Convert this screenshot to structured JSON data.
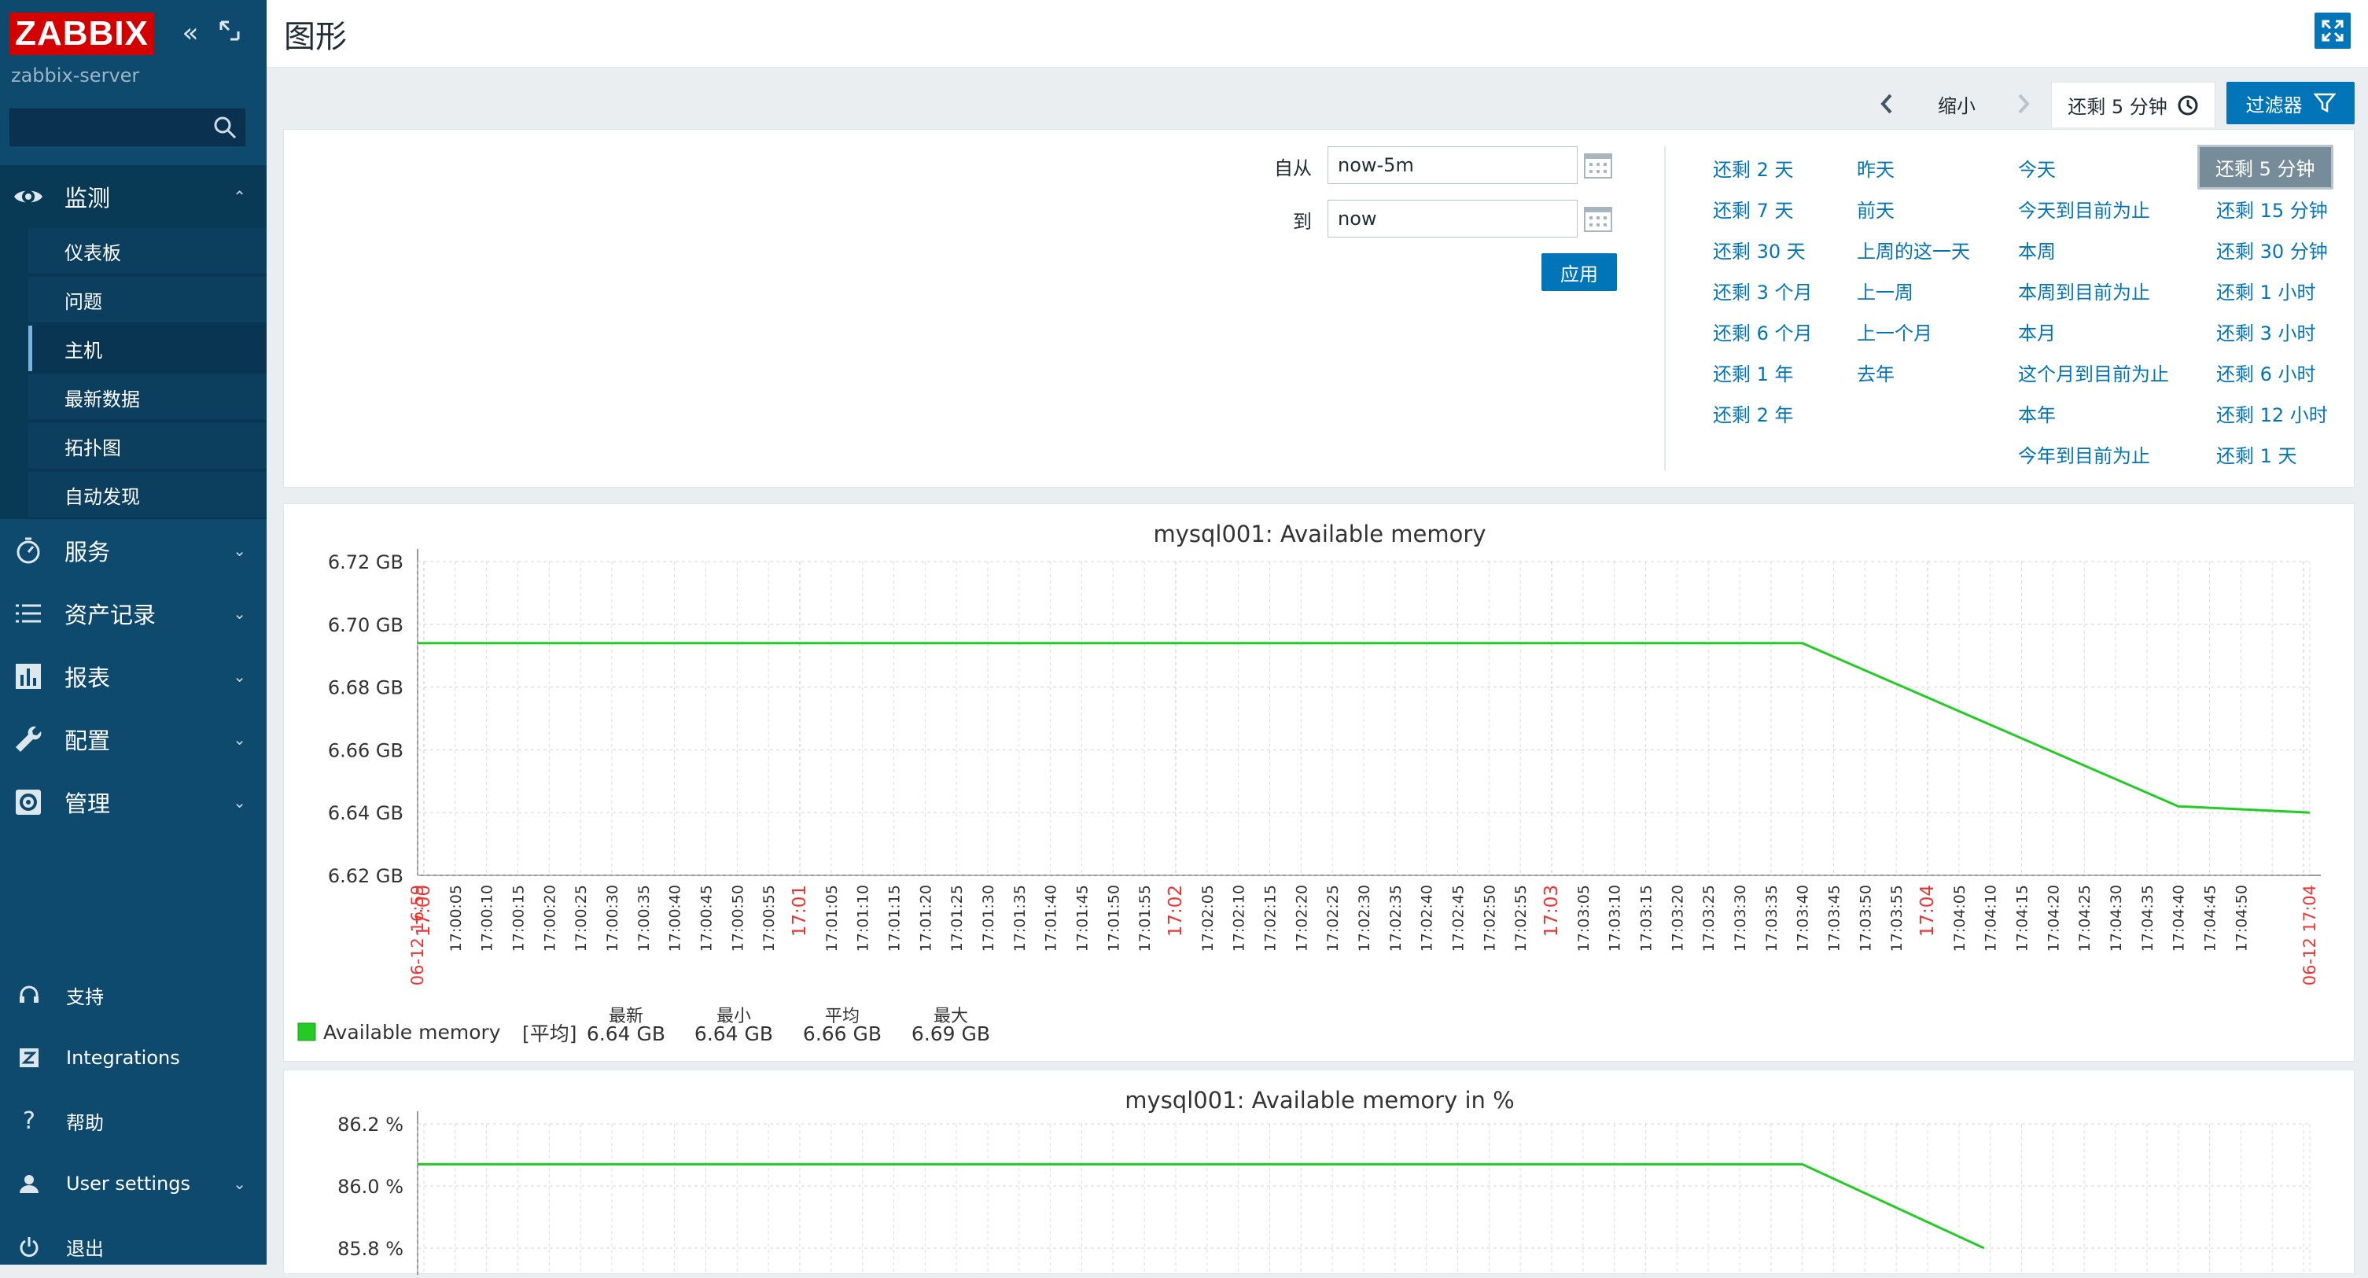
{
  "sidebar": {
    "logo": "ZABBIX",
    "server": "zabbix-server",
    "search_placeholder": "",
    "monitor": {
      "label": "监测",
      "items": [
        "仪表板",
        "问题",
        "主机",
        "最新数据",
        "拓扑图",
        "自动发现"
      ],
      "active_index": 2
    },
    "sections": [
      "服务",
      "资产记录",
      "报表",
      "配置",
      "管理"
    ],
    "footer": [
      "支持",
      "Integrations",
      "帮助",
      "User settings",
      "退出"
    ]
  },
  "header": {
    "title": "图形"
  },
  "timebar": {
    "zoom_out": "缩小",
    "active_tab": "还剩 5 分钟",
    "filter": "过滤器"
  },
  "filter": {
    "from_label": "自从",
    "from_value": "now-5m",
    "to_label": "到",
    "to_value": "now",
    "apply": "应用",
    "quick": [
      [
        "还剩 2 天",
        "还剩 7 天",
        "还剩 30 天",
        "还剩 3 个月",
        "还剩 6 个月",
        "还剩 1 年",
        "还剩 2 年"
      ],
      [
        "昨天",
        "前天",
        "上周的这一天",
        "上一周",
        "上一个月",
        "去年"
      ],
      [
        "今天",
        "今天到目前为止",
        "本周",
        "本周到目前为止",
        "本月",
        "这个月到目前为止",
        "本年",
        "今年到目前为止"
      ],
      [
        "还剩 5 分钟",
        "还剩 15 分钟",
        "还剩 30 分钟",
        "还剩 1 小时",
        "还剩 3 小时",
        "还剩 6 小时",
        "还剩 12 小时",
        "还剩 1 天"
      ]
    ]
  },
  "chart_data": [
    {
      "type": "line",
      "title": "mysql001: Available memory",
      "y_ticks": [
        "6.72 GB",
        "6.70 GB",
        "6.68 GB",
        "6.66 GB",
        "6.64 GB",
        "6.62 GB"
      ],
      "ylim": [
        6.62,
        6.72
      ],
      "x_start_label": "06-12 16:59",
      "x_end_label": "06-12 17:04",
      "x_minute_labels": [
        "17:00",
        "17:01",
        "17:02",
        "17:03",
        "17:04"
      ],
      "x_sec_labels": [
        "17:00:05",
        "17:00:10",
        "17:00:15",
        "17:00:20",
        "17:00:25",
        "17:00:30",
        "17:00:35",
        "17:00:40",
        "17:00:45",
        "17:00:50",
        "17:00:55",
        "17:01:05",
        "17:01:10",
        "17:01:15",
        "17:01:20",
        "17:01:25",
        "17:01:30",
        "17:01:35",
        "17:01:40",
        "17:01:45",
        "17:01:50",
        "17:01:55",
        "17:02:05",
        "17:02:10",
        "17:02:15",
        "17:02:20",
        "17:02:25",
        "17:02:30",
        "17:02:35",
        "17:02:40",
        "17:02:45",
        "17:02:50",
        "17:02:55",
        "17:03:05",
        "17:03:10",
        "17:03:15",
        "17:03:20",
        "17:03:25",
        "17:03:30",
        "17:03:35",
        "17:03:40",
        "17:03:45",
        "17:03:50",
        "17:03:55",
        "17:04:05",
        "17:04:10",
        "17:04:15",
        "17:04:20",
        "17:04:25",
        "17:04:30",
        "17:04:35",
        "17:04:40",
        "17:04:45",
        "17:04:50"
      ],
      "series": [
        {
          "name": "Available memory",
          "color": "#22cc22",
          "x_seconds": [
            0,
            221,
            281,
            302
          ],
          "values": [
            6.694,
            6.694,
            6.642,
            6.64
          ]
        }
      ],
      "legend": {
        "func": "[平均]",
        "stat_labels": [
          "最新",
          "最小",
          "平均",
          "最大"
        ],
        "stat_values": [
          "6.64 GB",
          "6.64 GB",
          "6.66 GB",
          "6.69 GB"
        ]
      }
    },
    {
      "type": "line",
      "title": "mysql001: Available memory in %",
      "y_ticks": [
        "86.2 %",
        "86.0 %",
        "85.8 %"
      ],
      "ylim": [
        85.8,
        86.2
      ],
      "series": [
        {
          "name": "Available memory in %",
          "color": "#22cc22",
          "x_seconds": [
            0,
            221,
            250
          ],
          "values": [
            86.07,
            86.07,
            85.8
          ]
        }
      ]
    }
  ]
}
